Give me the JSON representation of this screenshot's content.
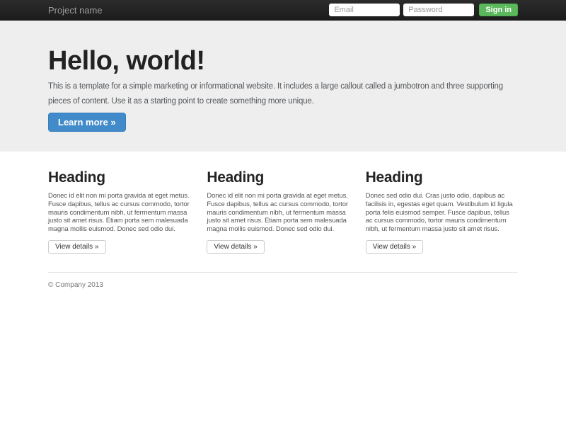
{
  "navbar": {
    "brand": "Project name",
    "form": {
      "email_placeholder": "Email",
      "password_placeholder": "Password",
      "signin_label": "Sign in"
    }
  },
  "jumbotron": {
    "title": "Hello, world!",
    "description": "This is a template for a simple marketing or informational website. It includes a large callout called a jumbotron and three supporting pieces of content. Use it as a starting point to create something more unique.",
    "cta_label": "Learn more »"
  },
  "columns": [
    {
      "heading": "Heading",
      "text": "Donec id elit non mi porta gravida at eget metus. Fusce dapibus, tellus ac cursus commodo, tortor mauris condimentum nibh, ut fermentum massa justo sit amet risus. Etiam porta sem malesuada magna mollis euismod. Donec sed odio dui.",
      "button_label": "View details »"
    },
    {
      "heading": "Heading",
      "text": "Donec id elit non mi porta gravida at eget metus. Fusce dapibus, tellus ac cursus commodo, tortor mauris condimentum nibh, ut fermentum massa justo sit amet risus. Etiam porta sem malesuada magna mollis euismod. Donec sed odio dui.",
      "button_label": "View details »"
    },
    {
      "heading": "Heading",
      "text": "Donec sed odio dui. Cras justo odio, dapibus ac facilisis in, egestas eget quam. Vestibulum id ligula porta felis euismod semper. Fusce dapibus, tellus ac cursus commodo, tortor mauris condimentum nibh, ut fermentum massa justo sit amet risus.",
      "button_label": "View details »"
    }
  ],
  "footer": {
    "copyright": "© Company 2013"
  },
  "colors": {
    "primary": "#428bca",
    "primary_border": "#357ebd",
    "success": "#5cb85c",
    "success_border": "#4cae4c",
    "navbar_bg": "#222222",
    "jumbotron_bg": "#eeeeee"
  }
}
